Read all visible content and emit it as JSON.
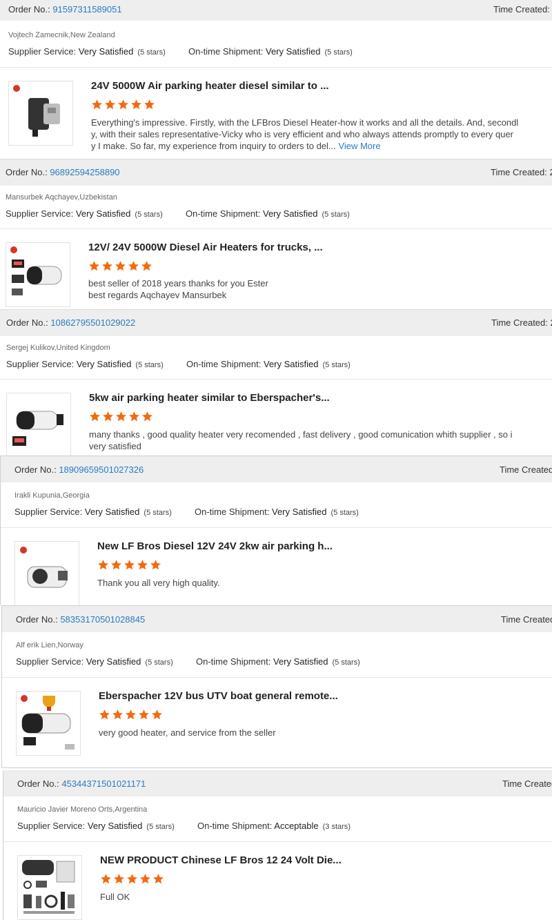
{
  "labels": {
    "order_no": "Order No.:",
    "time_created": "Time Created:",
    "time_created_short": "Time Created",
    "supplier_service": "Supplier Service:",
    "ontime_shipment": "On-time Shipment:",
    "view_more": "View More"
  },
  "colors": {
    "star": "#f26a10",
    "link": "#2a7ac0",
    "bar": "#eeeeee"
  },
  "reviews": [
    {
      "order_no": "91597311589051",
      "time_suffix": "",
      "buyer": "Vojtech Zamecnik,New Zealand",
      "supplier_service": "Very Satisfied",
      "supplier_stars": "(5 stars)",
      "shipment": "Very Satisfied",
      "shipment_stars": "(5 stars)",
      "product_title": "24V 5000W Air parking heater diesel similar to ...",
      "rating": 5,
      "text_lines": [
        "Everything's impressive. Firstly, with the LFBros Diesel Heater-how it works and all the details. And, secondl",
        "y, with their sales representative-Vicky who is very efficient and who always attends promptly to every quer",
        "y I make. So far, my experience from inquiry to orders to del..."
      ],
      "thumb_icon": "heater-product-image"
    },
    {
      "order_no": "96892594258890",
      "time_suffix": "2",
      "buyer": "Mansurbek Aqchayev,Uzbekistan",
      "supplier_service": "Very Satisfied",
      "supplier_stars": "(5 stars)",
      "shipment": "Very Satisfied",
      "shipment_stars": "(5 stars)",
      "product_title": "12V/ 24V 5000W Diesel Air Heaters for trucks, ...",
      "rating": 5,
      "text_lines": [
        "best seller of 2018 years thanks for you Ester",
        "best regards Aqchayev Mansurbek"
      ],
      "thumb_icon": "heater-kit-image"
    },
    {
      "order_no": "10862795501029022",
      "time_suffix": "2",
      "buyer": "Sergej Kulikov,United Kingdom",
      "supplier_service": "Very Satisfied",
      "supplier_stars": "(5 stars)",
      "shipment": "Very Satisfied",
      "shipment_stars": "(5 stars)",
      "product_title": "5kw air parking heater similar to Eberspacher's...",
      "rating": 5,
      "text_lines": [
        "many thanks , good quality heater very recomended , fast delivery , good comunication whith supplier , so i",
        "very satisfied"
      ],
      "thumb_icon": "heater-product-image"
    },
    {
      "order_no": "18909659501027326",
      "time_suffix": "",
      "buyer": "Irakli Kupunia,Georgia",
      "supplier_service": "Very Satisfied",
      "supplier_stars": "(5 stars)",
      "shipment": "Very Satisfied",
      "shipment_stars": "(5 stars)",
      "product_title": "New LF Bros Diesel 12V 24V 2kw air parking h...",
      "rating": 5,
      "text_lines": [
        "Thank you all very high quality."
      ],
      "thumb_icon": "heater-product-image"
    },
    {
      "order_no": "58353170501028845",
      "time_suffix": "",
      "buyer": "Alf erik Lien,Norway",
      "supplier_service": "Very Satisfied",
      "supplier_stars": "(5 stars)",
      "shipment": "Very Satisfied",
      "shipment_stars": "(5 stars)",
      "product_title": "Eberspacher 12V bus UTV boat general remote...",
      "rating": 5,
      "text_lines": [
        "very good heater, and service from the seller"
      ],
      "thumb_icon": "heater-trophy-image"
    },
    {
      "order_no": "45344371501021171",
      "time_suffix": "",
      "buyer": "Mauricio Javier Moreno Orts,Argentina",
      "supplier_service": "Very Satisfied",
      "supplier_stars": "(5 stars)",
      "shipment": "Acceptable",
      "shipment_stars": "(3 stars)",
      "product_title": "NEW PRODUCT Chinese LF Bros 12 24 Volt Die...",
      "rating": 5,
      "text_lines": [
        "Full OK"
      ],
      "thumb_icon": "heater-parts-image"
    }
  ]
}
